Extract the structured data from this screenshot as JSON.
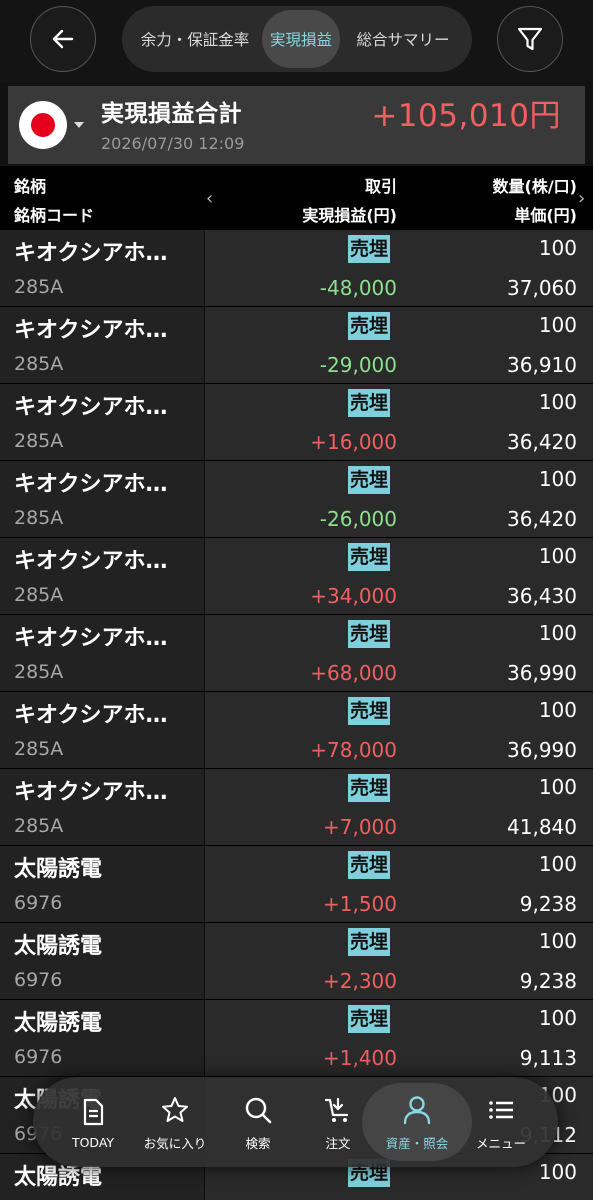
{
  "tabs": [
    "余力・保証金率",
    "実現損益",
    "総合サマリー"
  ],
  "active_tab": "実現損益",
  "summary": {
    "title": "実現損益合計",
    "datetime": "2026/07/30 12:09",
    "total": "+105,010円"
  },
  "columns": {
    "col1_line1": "銘柄",
    "col1_line2": "銘柄コード",
    "col2_line1": "取引",
    "col2_line2": "実現損益(円)",
    "col3_line1": "数量(株/口)",
    "col3_line2": "単価(円)"
  },
  "rows": [
    {
      "name": "キオクシアホ…",
      "code": "285A",
      "trade": "売埋",
      "pl": "-48,000",
      "pl_sign": "neg",
      "qty": "100",
      "price": "37,060"
    },
    {
      "name": "キオクシアホ…",
      "code": "285A",
      "trade": "売埋",
      "pl": "-29,000",
      "pl_sign": "neg",
      "qty": "100",
      "price": "36,910"
    },
    {
      "name": "キオクシアホ…",
      "code": "285A",
      "trade": "売埋",
      "pl": "+16,000",
      "pl_sign": "pos",
      "qty": "100",
      "price": "36,420"
    },
    {
      "name": "キオクシアホ…",
      "code": "285A",
      "trade": "売埋",
      "pl": "-26,000",
      "pl_sign": "neg",
      "qty": "100",
      "price": "36,420"
    },
    {
      "name": "キオクシアホ…",
      "code": "285A",
      "trade": "売埋",
      "pl": "+34,000",
      "pl_sign": "pos",
      "qty": "100",
      "price": "36,430"
    },
    {
      "name": "キオクシアホ…",
      "code": "285A",
      "trade": "売埋",
      "pl": "+68,000",
      "pl_sign": "pos",
      "qty": "100",
      "price": "36,990"
    },
    {
      "name": "キオクシアホ…",
      "code": "285A",
      "trade": "売埋",
      "pl": "+78,000",
      "pl_sign": "pos",
      "qty": "100",
      "price": "36,990"
    },
    {
      "name": "キオクシアホ…",
      "code": "285A",
      "trade": "売埋",
      "pl": "+7,000",
      "pl_sign": "pos",
      "qty": "100",
      "price": "41,840"
    },
    {
      "name": "太陽誘電",
      "code": "6976",
      "trade": "売埋",
      "pl": "+1,500",
      "pl_sign": "pos",
      "qty": "100",
      "price": "9,238"
    },
    {
      "name": "太陽誘電",
      "code": "6976",
      "trade": "売埋",
      "pl": "+2,300",
      "pl_sign": "pos",
      "qty": "100",
      "price": "9,238"
    },
    {
      "name": "太陽誘電",
      "code": "6976",
      "trade": "売埋",
      "pl": "+1,400",
      "pl_sign": "pos",
      "qty": "100",
      "price": "9,113"
    },
    {
      "name": "太陽誘電",
      "code": "6976",
      "trade": "",
      "pl": "",
      "pl_sign": "pos",
      "qty": "100",
      "price": "9,112"
    },
    {
      "name": "太陽誘電",
      "code": "",
      "trade": "売埋",
      "pl": "",
      "pl_sign": "pos",
      "qty": "100",
      "price": ""
    }
  ],
  "nav": [
    {
      "label": "TODAY",
      "icon": "document-icon"
    },
    {
      "label": "お気に入り",
      "icon": "star-icon"
    },
    {
      "label": "検索",
      "icon": "search-icon"
    },
    {
      "label": "注文",
      "icon": "cart-icon"
    },
    {
      "label": "資産・照会",
      "icon": "person-icon"
    },
    {
      "label": "メニュー",
      "icon": "menu-list-icon"
    }
  ],
  "colors": {
    "accent": "#86d7e1",
    "positive": "#f06060",
    "negative": "#8ee08e",
    "badge": "#7fd0dc"
  }
}
